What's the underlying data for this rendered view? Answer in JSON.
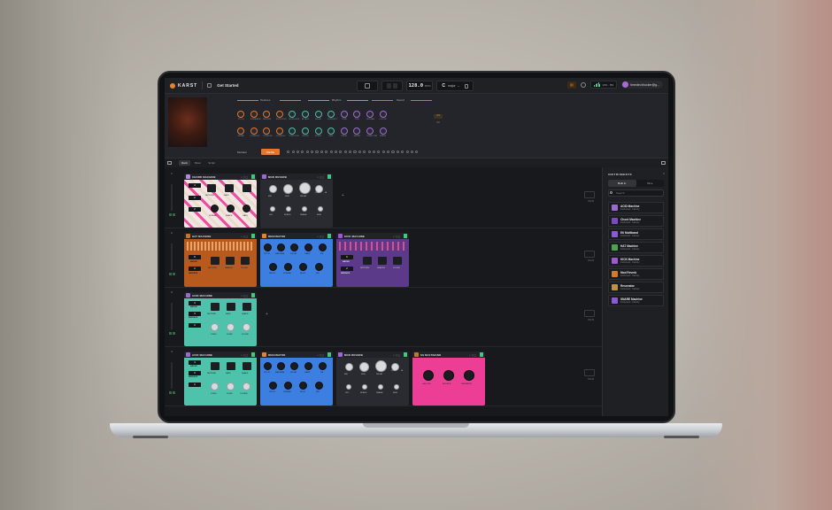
{
  "app": {
    "name": "KARST",
    "project_title": "Get Started",
    "bpm": "128.0",
    "bpm_unit": "BPM",
    "key": "C",
    "scale": "major",
    "cpu": "13% · 8%",
    "user": "timedev.blocker@g..."
  },
  "colors": {
    "accent": "#e5762b",
    "toggle_on": "#45c87b"
  },
  "macro": {
    "groups": [
      "Textures",
      "Rhythm",
      "Sound"
    ],
    "row1_labels": [
      "PITCH",
      "SCRAMBLE",
      "REVERB",
      "ENTROPHY",
      "MODULATE",
      "ATTACK",
      "DECAY",
      "INTENSITY",
      "TONE",
      "TIDE",
      "SUSTAIN",
      "COLOR"
    ],
    "row2_labels": [
      "SIGMA",
      "COMPLEX",
      "COMPLEX",
      "COMPLEX",
      "CONTOUR",
      "GROW",
      "SPEED",
      "FEEL",
      "DRIVE",
      "SWING",
      "OVERTONE",
      "SPACE"
    ],
    "variation_label": "Modular",
    "randomize_label": "Shuffle",
    "badge": "1/4",
    "badge2": "1/2"
  },
  "tabs": [
    "Rack",
    "Mixer",
    "Script"
  ],
  "tracks": [
    {
      "number": "1",
      "devices": [
        {
          "title": "CHORD MACHINE",
          "type": "chord",
          "labels": [
            "PATTERN",
            "RATE",
            "SPREAD",
            "SHAPE",
            "GATE"
          ],
          "steps": [
            "4",
            "2",
            "2"
          ]
        },
        {
          "title": "MOD REVERB",
          "type": "reverb",
          "labels": [
            "MIX",
            "SIZE",
            "DECAY",
            "LOW",
            "HI",
            "LFO",
            "SPEED",
            "PHASE",
            "MOD"
          ]
        }
      ]
    },
    {
      "number": "2",
      "devices": [
        {
          "title": "HAT MACHINE",
          "type": "hat",
          "labels": [
            "METER",
            "REPEATS",
            "PATTERN",
            "SHADES",
            "SOUND"
          ],
          "steps": [
            "6",
            "2"
          ]
        },
        {
          "title": "RESONATOR",
          "type": "resonator",
          "labels": [
            "PITCH",
            "MATERIAL",
            "DECAY",
            "DAMP",
            "FM",
            "WIDTH",
            "SPREAD",
            "BLUR",
            "MIX"
          ]
        },
        {
          "title": "KICK MACHINE",
          "type": "kick",
          "labels": [
            "METER",
            "REPEATS",
            "PATTERN",
            "SHADES",
            "SOUND"
          ],
          "steps": [
            "6",
            "2"
          ]
        }
      ]
    },
    {
      "number": "3",
      "devices": [
        {
          "title": "ACID MACHINE",
          "type": "acid",
          "labels": [
            "METER",
            "REPEATS",
            "PATTERN",
            "RATE",
            "SHAPE",
            "STEEL",
            "FORM",
            "SOUND"
          ],
          "steps": [
            "4",
            "3",
            "2"
          ]
        }
      ]
    },
    {
      "number": "4",
      "devices": [
        {
          "title": "ACID MACHINE",
          "type": "acid",
          "labels": [
            "METER",
            "REPEATS",
            "PATTERN",
            "RATE",
            "SHAPE",
            "STEEL",
            "FORM",
            "OCTAVE"
          ],
          "steps": [
            "4",
            "3",
            "2"
          ]
        },
        {
          "title": "RESONATOR",
          "type": "resonator",
          "labels": [
            "PITCH",
            "MATERIAL",
            "DECAY",
            "DAMP",
            "FM",
            "WIDTH",
            "SPREAD",
            "BLUR",
            "MIX"
          ]
        },
        {
          "title": "MOD REVERB",
          "type": "reverb",
          "labels": [
            "MIX",
            "SIZE",
            "DECAY",
            "LOW",
            "HI",
            "LFO",
            "SPEED",
            "PHASE",
            "MOD"
          ]
        },
        {
          "title": "SS MULTIBAND",
          "type": "multiband",
          "labels": [
            "GROOVE",
            "BOUNCE",
            "PRESENCE"
          ]
        }
      ]
    }
  ],
  "track_end_label": "PLUS",
  "instruments_panel": {
    "title": "INSTRUMENTS",
    "segments": [
      "Built In",
      "Mine"
    ],
    "search_placeholder": "Search",
    "items": [
      {
        "name": "ACID Machine",
        "sub": "Instrument · Factory",
        "color": "#9a6ad0"
      },
      {
        "name": "Chord Machine",
        "sub": "Instrument · Factory",
        "color": "#7a4ac0"
      },
      {
        "name": "Eti Multiband",
        "sub": "Instrument · Factory",
        "color": "#8a5ad0"
      },
      {
        "name": "HAT Machine",
        "sub": "Instrument · Factory",
        "color": "#4fa050"
      },
      {
        "name": "KICK Machine",
        "sub": "Instrument · Factory",
        "color": "#9a5ad0"
      },
      {
        "name": "Mod Reverb",
        "sub": "Instrument · Factory",
        "color": "#d07a30"
      },
      {
        "name": "Resonator",
        "sub": "Instrument · Factory",
        "color": "#c09040"
      },
      {
        "name": "SNARE Machine",
        "sub": "Instrument · Factory",
        "color": "#8a5ad0"
      }
    ]
  }
}
